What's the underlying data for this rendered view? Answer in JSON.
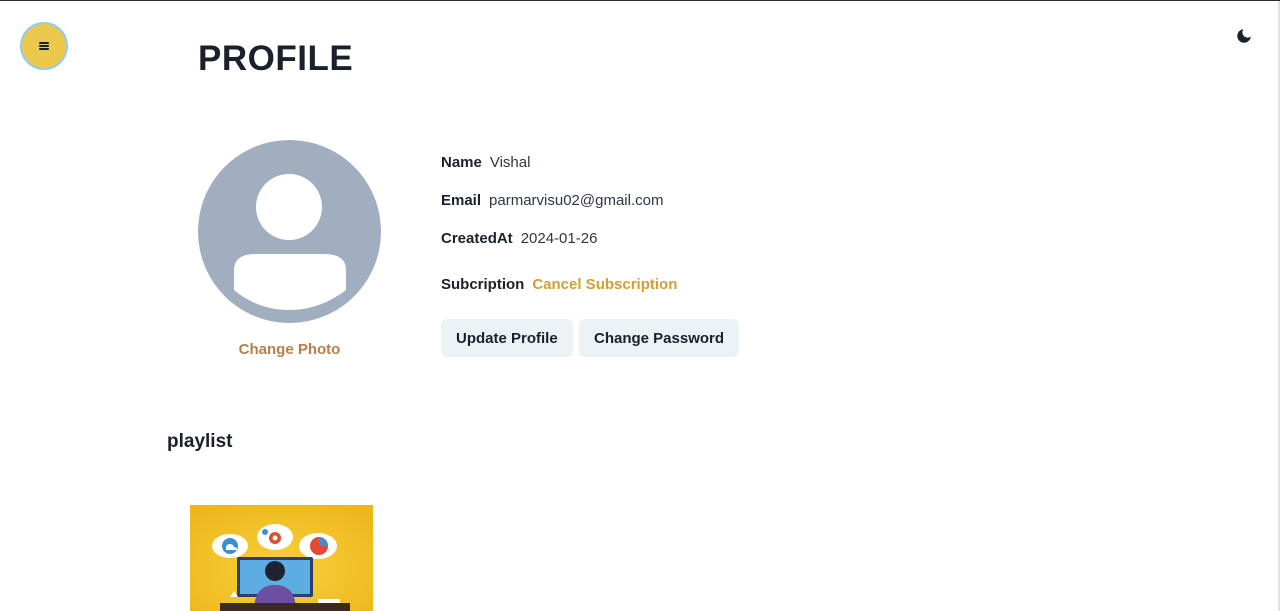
{
  "header": {
    "title": "PROFILE"
  },
  "icons": {
    "menu": "menu-icon",
    "theme_toggle": "moon-icon"
  },
  "colors": {
    "menu_bg": "#ecc94b",
    "menu_ring": "#90cdf4",
    "avatar_bg": "#a0aec0",
    "accent_link": "#d69e2e",
    "change_photo": "#b7804a",
    "button_bg": "#edf2f7"
  },
  "profile": {
    "change_photo_label": "Change Photo",
    "fields": {
      "name_label": "Name",
      "name_value": "Vishal",
      "email_label": "Email",
      "email_value": "parmarvisu02@gmail.com",
      "created_label": "CreatedAt",
      "created_value": "2024-01-26",
      "subscription_label": "Subcription",
      "subscription_action": "Cancel Subscription"
    },
    "buttons": {
      "update": "Update Profile",
      "change_password": "Change Password"
    }
  },
  "playlist": {
    "title": "playlist"
  }
}
